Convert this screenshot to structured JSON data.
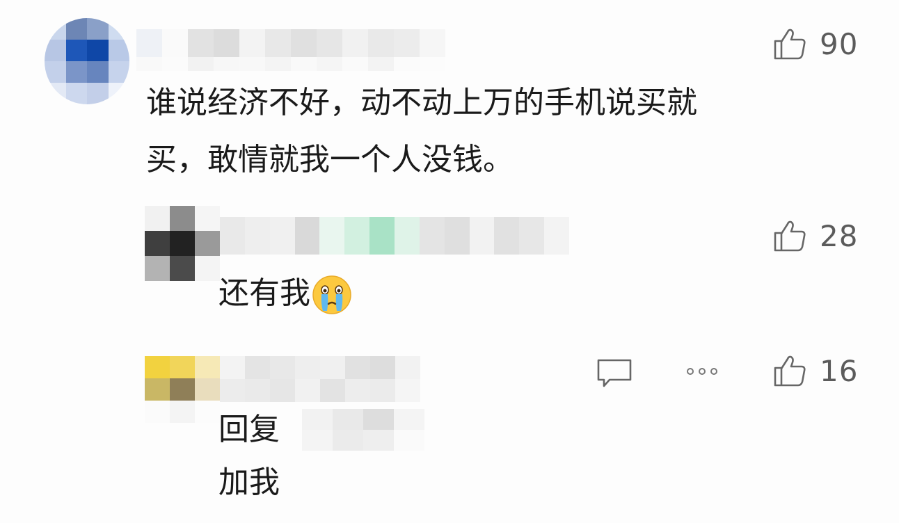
{
  "comments": [
    {
      "text_line1": "谁说经济不好，动不动上万的手机说买就",
      "text_line2": "买，敢情就我一个人没钱。",
      "likes": "90"
    },
    {
      "text": "还有我",
      "emoji": "crying-face",
      "likes": "28"
    },
    {
      "reply_label": "回复",
      "text": "加我",
      "likes": "16",
      "actions": [
        "reply-icon",
        "more-icon"
      ]
    }
  ],
  "colors": {
    "background": "#fdfdfd",
    "text": "#1a1a1a",
    "count": "#5b5b5b",
    "icon": "#666666"
  }
}
